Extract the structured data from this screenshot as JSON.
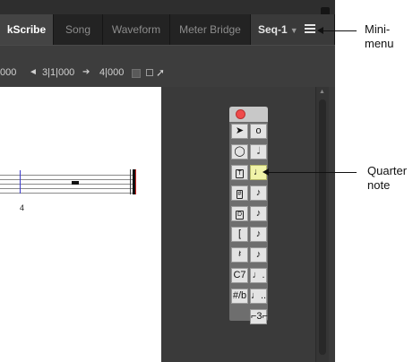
{
  "tabs": [
    {
      "name": "tab-notescribe",
      "label": "kScribe",
      "active": true
    },
    {
      "name": "tab-song",
      "label": "Song",
      "active": false
    },
    {
      "name": "tab-waveform",
      "label": "Waveform",
      "active": false
    },
    {
      "name": "tab-meter-bridge",
      "label": "Meter Bridge",
      "active": false
    }
  ],
  "sequence": {
    "label": "Seq-1",
    "arrow": "▼"
  },
  "toolbar": {
    "pos_left": "000",
    "arrow_left": "◄",
    "pos_mid": "3|1|000",
    "arrow_right": "➔",
    "pos_right": "4|000"
  },
  "score": {
    "measure_number": "4"
  },
  "palette": {
    "tools": [
      {
        "name": "select-tool",
        "glyph": "➤",
        "selected": false
      },
      {
        "name": "erase-tool",
        "glyph": "o",
        "selected": false
      },
      {
        "name": "loop-tool",
        "glyph": "◯",
        "selected": false
      },
      {
        "name": "half-note-tool",
        "glyph": "𝅗𝅥",
        "selected": false
      },
      {
        "name": "tuplet-tool",
        "glyph": "T",
        "selected": false,
        "boxed": true
      },
      {
        "name": "quarter-note-tool",
        "glyph": "♩",
        "selected": true
      },
      {
        "name": "sharp-tool",
        "glyph": "#",
        "selected": false,
        "boxed": true
      },
      {
        "name": "eighth-note-tool",
        "glyph": "♪",
        "selected": false
      },
      {
        "name": "dynamic-tool",
        "glyph": "D",
        "selected": false,
        "boxed": true
      },
      {
        "name": "sixteenth-note-tool",
        "glyph": "♪",
        "selected": false
      },
      {
        "name": "bracket-tool",
        "glyph": "[",
        "selected": false
      },
      {
        "name": "thirty-second-note-tool",
        "glyph": "♪",
        "selected": false
      },
      {
        "name": "rest-tool",
        "glyph": "𝄽",
        "selected": false
      },
      {
        "name": "sixty-fourth-note-tool",
        "glyph": "♪",
        "selected": false
      },
      {
        "name": "chord-symbol-tool",
        "glyph": "C7",
        "selected": false
      },
      {
        "name": "dotted-note-tool",
        "glyph": "♩.",
        "selected": false
      },
      {
        "name": "time-signature-tool",
        "glyph": "#/b",
        "selected": false
      },
      {
        "name": "double-dotted-note-tool",
        "glyph": "♩..",
        "selected": false
      },
      {
        "name": "triplet-tool",
        "glyph": "⌐3⌐",
        "selected": false
      }
    ]
  },
  "annotations": {
    "minimenu_line1": "Mini-",
    "minimenu_line2": "menu",
    "quarter_line1": "Quarter",
    "quarter_line2": "note"
  },
  "colors": {
    "selected_tool": "#f0f3a8",
    "close_button": "#ef4b4b",
    "barline": "#3c3ccc"
  }
}
